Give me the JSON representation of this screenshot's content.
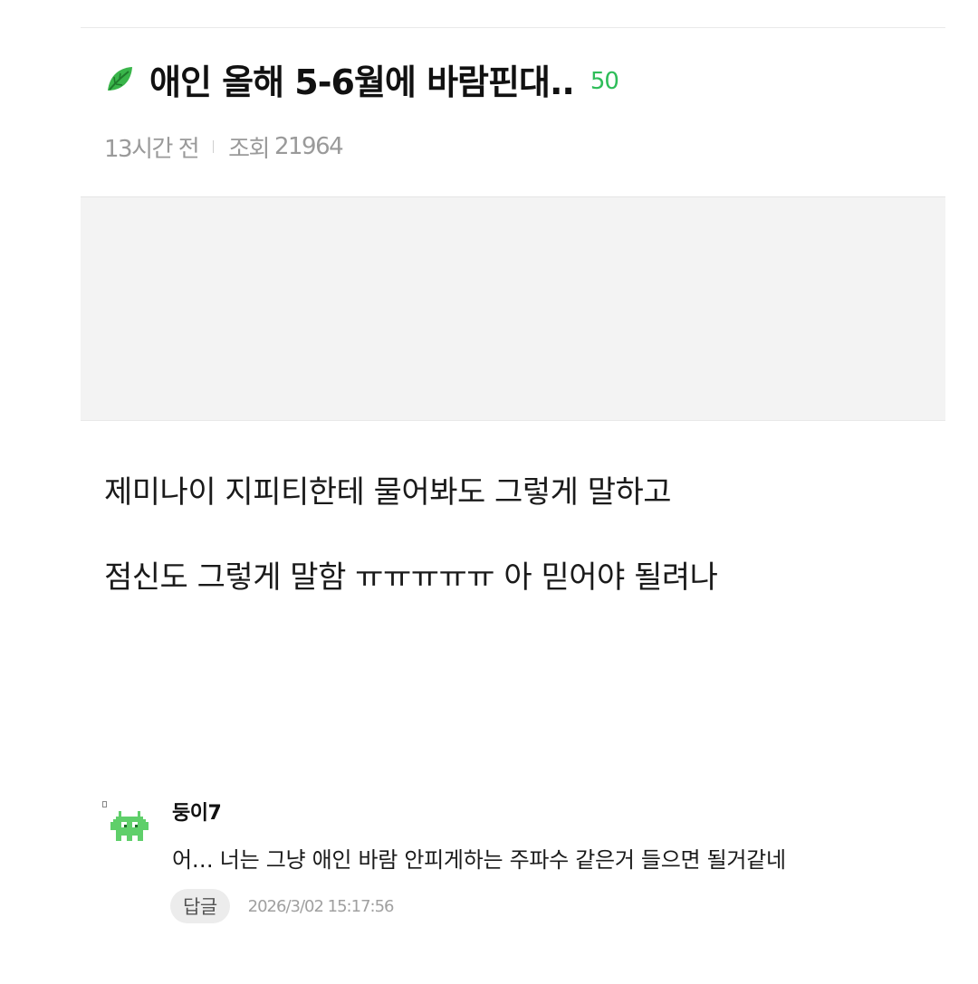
{
  "post": {
    "title": "애인 올해 5-6월에 바람핀대..",
    "comment_count": "50",
    "time_ago": "13시간 전",
    "views_label": "조회",
    "views": "21964",
    "body_lines": [
      "제미나이 지피티한테 물어봐도 그렇게 말하고",
      "점신도 그렇게 말함 ㅠㅠㅠㅠㅠ 아 믿어야 될려나"
    ]
  },
  "comment": {
    "author": "둥이7",
    "text": "어… 너는 그냥 애인 바람 안피게하는 주파수 같은거 들으면 될거같네",
    "reply_label": "답글",
    "timestamp": "2026/3/02 15:17:56"
  },
  "icons": {
    "title_icon": "leaf-icon",
    "avatar_icon": "pixel-creature-avatar-icon"
  },
  "colors": {
    "accent_green": "#2ebd59",
    "meta_gray": "#9a9a9a",
    "ad_background": "#f3f3f3"
  }
}
